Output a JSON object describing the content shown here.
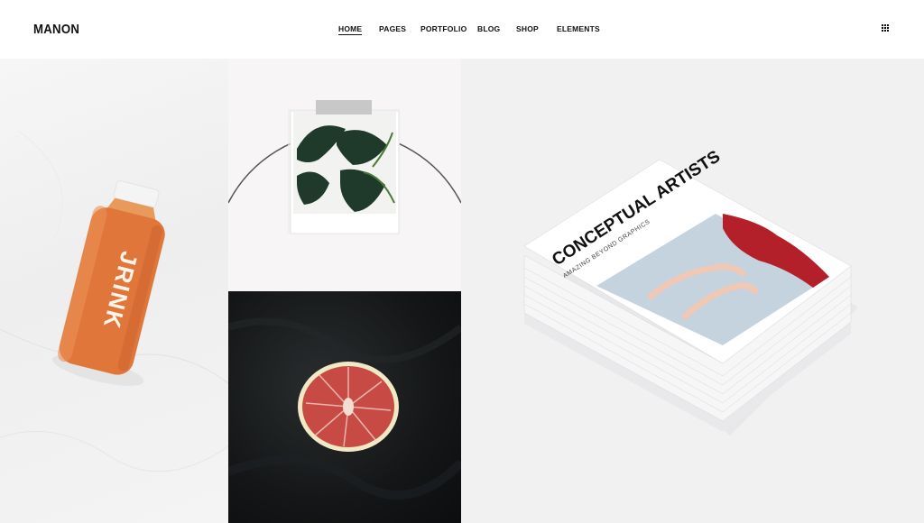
{
  "brand": {
    "logo_text": "MANON"
  },
  "nav": {
    "items": [
      {
        "label": "HOME",
        "active": true
      },
      {
        "label": "PAGES",
        "active": false
      },
      {
        "label": "PORTFOLIO",
        "active": false
      },
      {
        "label": "BLOG",
        "active": false
      },
      {
        "label": "SHOP",
        "active": false
      },
      {
        "label": "ELEMENTS",
        "active": false
      }
    ],
    "menu_icon": "grid-menu-icon"
  },
  "portfolio": {
    "tiles": [
      {
        "subject": "juice-bottle-photo",
        "bottle_text": "JRINK"
      },
      {
        "subject": "polaroid-plant-photo"
      },
      {
        "subject": "grapefruit-photo"
      },
      {
        "subject": "magazine-stack-photo",
        "cover_title": "CONCEPTUAL ARTISTS",
        "cover_subtitle": "AMAZING BEYOND GRAPHICS"
      }
    ]
  },
  "colors": {
    "text": "#111111",
    "bottle": "#e0763a",
    "grapefruit": "#c74a44"
  }
}
